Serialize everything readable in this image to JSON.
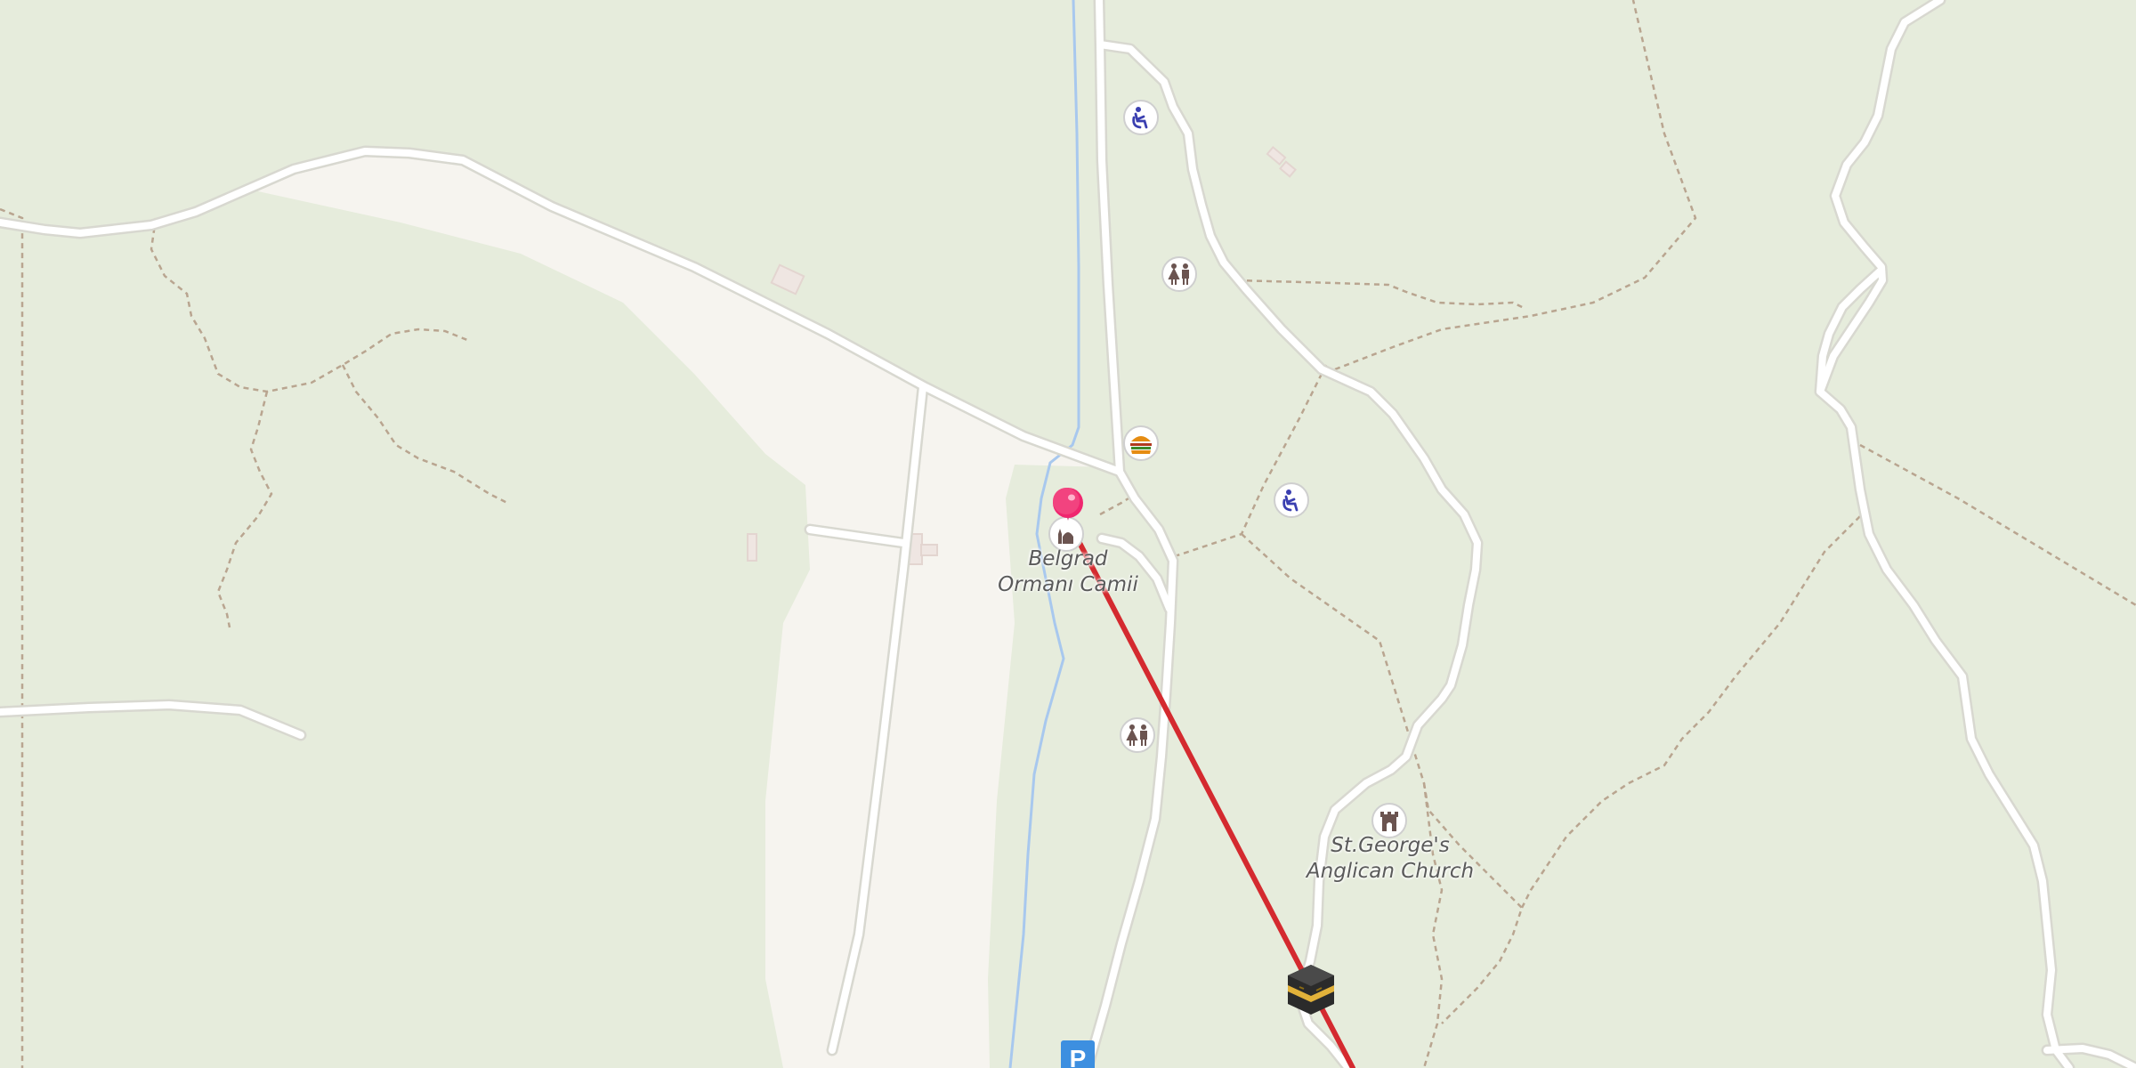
{
  "map": {
    "colors": {
      "background": "#e6ecdc",
      "clearing": "#f6f4ef",
      "road": "#ffffff",
      "road_casing": "#d8d8d0",
      "stream": "#a8c8ee",
      "path": "#b09a85",
      "route": "#d42a2f",
      "marker": "#f0266f",
      "poi_icon": "#6b5450",
      "parking": "#3d8fe0"
    },
    "labels": {
      "mosque_line1": "Belgrad",
      "mosque_line2": "Ormanı Camii",
      "church_line1": "St.George's",
      "church_line2": "Anglican Church",
      "parking": "P"
    },
    "pois": [
      {
        "name": "wheelchair-icon"
      },
      {
        "name": "toilets-icon"
      },
      {
        "name": "fast-food-icon"
      },
      {
        "name": "wheelchair-icon"
      },
      {
        "name": "mosque-icon"
      },
      {
        "name": "toilets-icon"
      },
      {
        "name": "church-icon"
      },
      {
        "name": "kaaba-icon"
      },
      {
        "name": "parking-icon"
      }
    ]
  }
}
